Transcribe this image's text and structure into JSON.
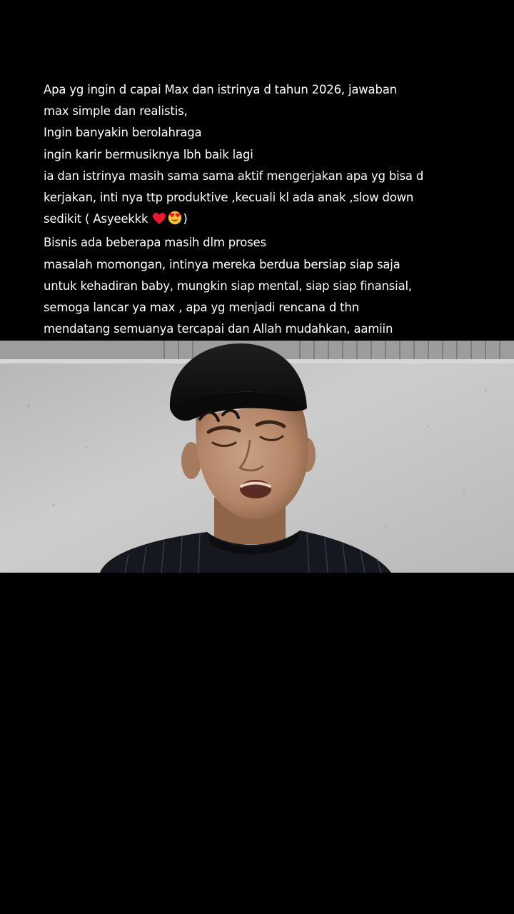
{
  "caption": {
    "lines": [
      "Apa yg ingin d capai Max dan istrinya d tahun 2026, jawaban",
      "max simple dan realistis,",
      "Ingin banyakin  berolahraga",
      "ingin karir bermusiknya lbh baik lagi",
      "ia dan istrinya masih sama sama aktif mengerjakan apa yg bisa d",
      "kerjakan, inti nya ttp produktive ,kecuali kl ada anak ,slow down",
      "sedikit ( Asyeekkk",
      ")",
      "Bisnis ada beberapa masih dlm proses",
      "masalah momongan, intinya mereka berdua bersiap siap saja",
      "untuk kehadiran baby, mungkin siap mental, siap siap finansial,",
      "semoga lancar ya max , apa yg menjadi rencana d thn",
      "mendatang semuanya tercapai dan Allah mudahkan, aamiin"
    ],
    "emojis": [
      "heart-icon",
      "heart-eyes-icon"
    ]
  },
  "video": {
    "description_icon": "person-singing-video",
    "colors": {
      "wall": "#c4c4c4",
      "cap": "#141414",
      "skin": "#b98a6b",
      "shirt": "#16181f"
    }
  },
  "colors": {
    "background": "#000000",
    "text": "#ffffff",
    "heart": "#e8192c",
    "emoji_face": "#f7c331"
  }
}
